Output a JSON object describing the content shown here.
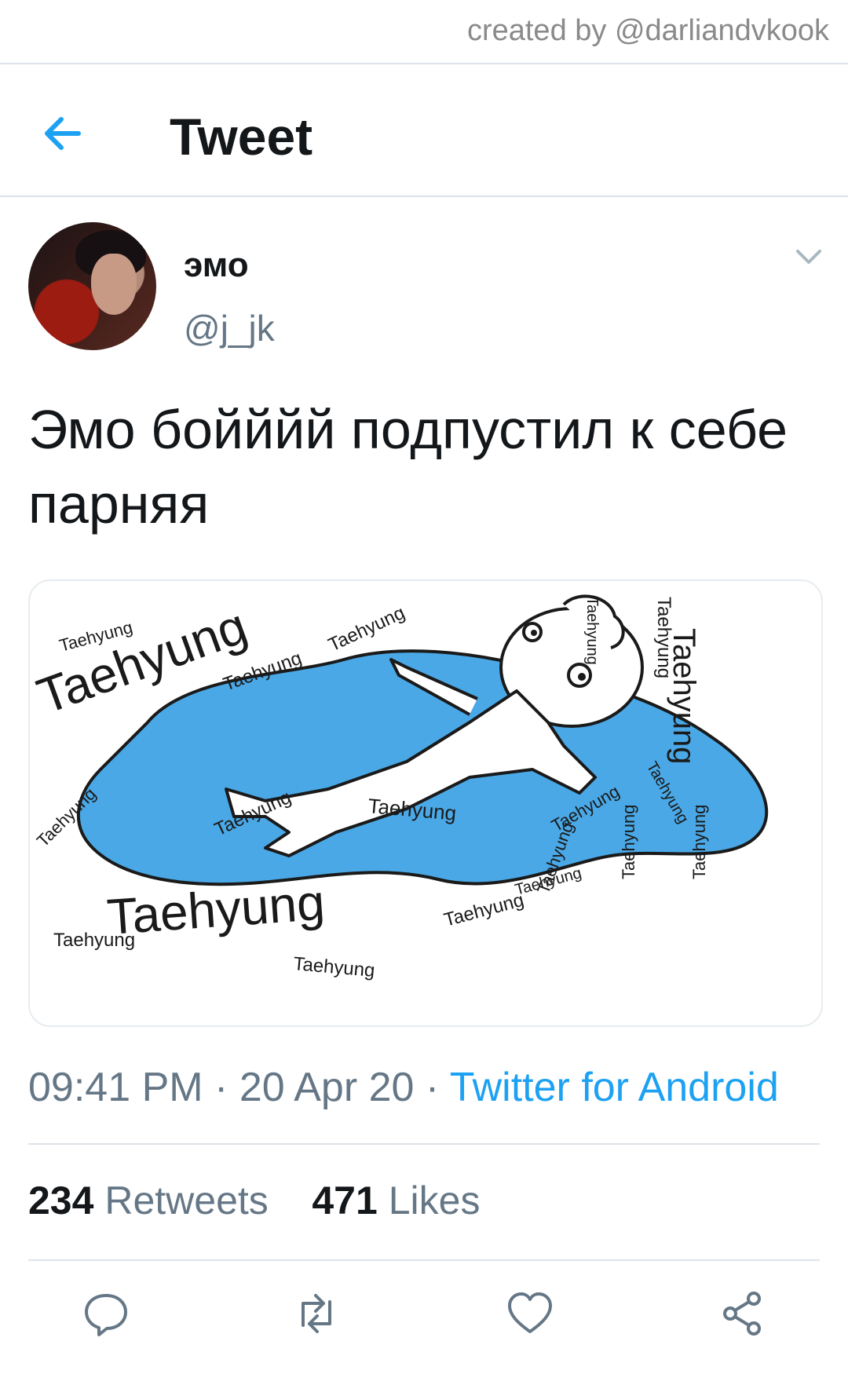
{
  "watermark": "created by @darliandvkook",
  "header": {
    "title": "Tweet",
    "back_icon": "arrow-left-icon"
  },
  "tweet": {
    "display_name": "эмо",
    "handle": "@j_jk",
    "text": "Эмо бойййй подпустил к себе парняя",
    "image": {
      "labels": [
        "Taehyung",
        "Taehyung",
        "Taehyung",
        "Taehyung",
        "Taehyung",
        "Taehyung",
        "Taehyung",
        "Taehyung",
        "Taehyung",
        "Taehyung",
        "Taehyung",
        "Taehyung",
        "Taehyung",
        "Taehyung",
        "Taehyung",
        "Taehyung",
        "Taehyung",
        "Taehyung",
        "Taehyung",
        "Taehyung"
      ]
    },
    "time": "09:41 PM",
    "date": "20 Apr 20",
    "separator": "·",
    "source": "Twitter for Android",
    "retweets": {
      "count": "234",
      "label": "Retweets"
    },
    "likes": {
      "count": "471",
      "label": "Likes"
    }
  },
  "actions": [
    "reply-icon",
    "retweet-icon",
    "like-icon",
    "share-icon"
  ],
  "colors": {
    "accent": "#1da1f2",
    "muted": "#657786",
    "text": "#14171a",
    "divider": "#dde3e8",
    "puddle": "#4aa8e6"
  }
}
